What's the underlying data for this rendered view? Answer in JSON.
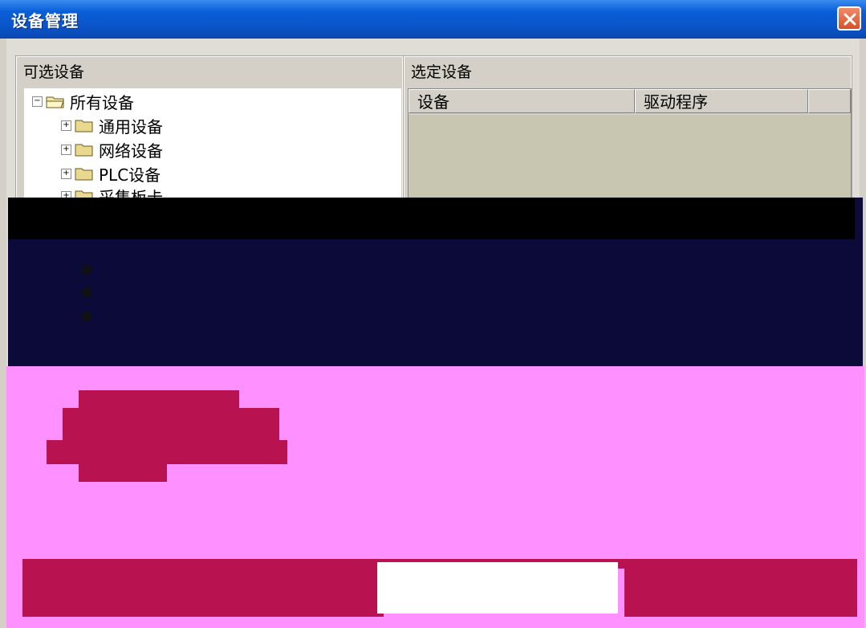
{
  "window": {
    "title": "设备管理",
    "close_icon": "close-icon"
  },
  "left_group": {
    "label": "可选设备",
    "tree": {
      "root": {
        "label": "所有设备",
        "expanded": true
      },
      "children": [
        {
          "label": "通用设备"
        },
        {
          "label": "网络设备"
        },
        {
          "label": "PLC设备"
        },
        {
          "label": "采集板卡"
        }
      ]
    }
  },
  "right_group": {
    "label": "选定设备",
    "columns": [
      "设备",
      "驱动程序"
    ]
  },
  "colors": {
    "title_bar": "#0a54c8",
    "panel": "#d4d0c8",
    "artifact_dark": "#0b0a38",
    "artifact_pink": "#ff90ff",
    "artifact_maroon": "#b81250"
  }
}
